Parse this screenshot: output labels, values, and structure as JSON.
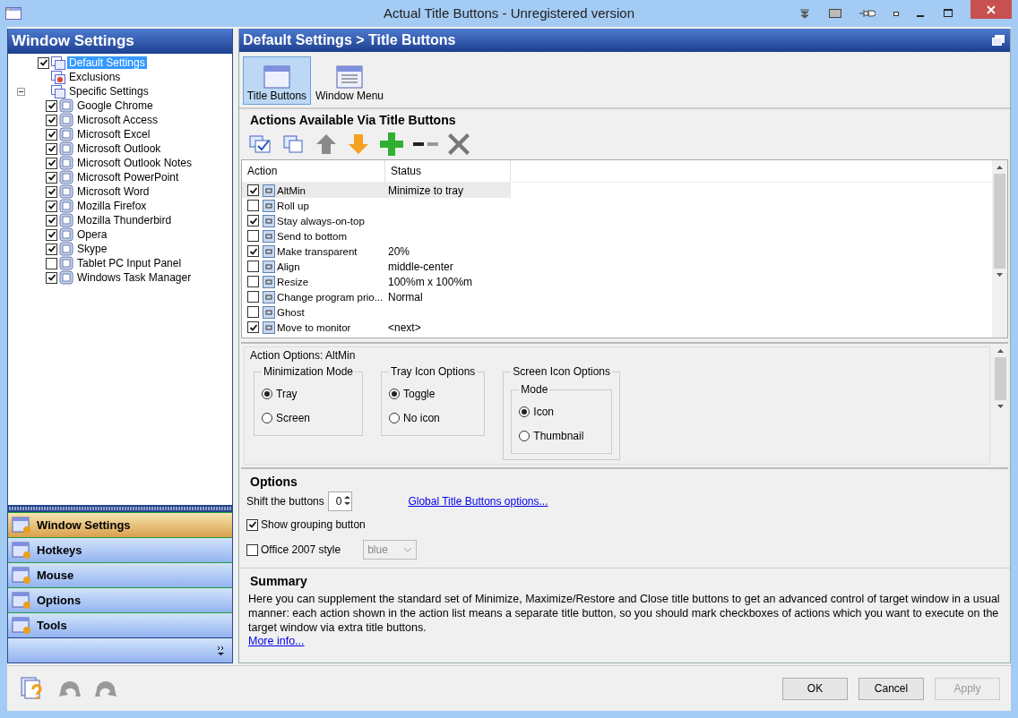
{
  "window": {
    "title": "Actual Title Buttons - Unregistered version"
  },
  "sidebar": {
    "title": "Window Settings",
    "tree": [
      {
        "label": "Default Settings",
        "checked": true,
        "selected": true
      },
      {
        "label": "Exclusions",
        "selected": false
      },
      {
        "label": "Specific Settings",
        "selected": false,
        "expanded": true,
        "children": [
          {
            "label": "Google Chrome",
            "checked": true,
            "selected": false
          },
          {
            "label": "Microsoft Access",
            "checked": true,
            "selected": false
          },
          {
            "label": "Microsoft Excel",
            "checked": true,
            "selected": false
          },
          {
            "label": "Microsoft Outlook",
            "checked": true,
            "selected": false
          },
          {
            "label": "Microsoft Outlook Notes",
            "checked": true,
            "selected": false
          },
          {
            "label": "Microsoft PowerPoint",
            "checked": true,
            "selected": false
          },
          {
            "label": "Microsoft Word",
            "checked": true,
            "selected": false
          },
          {
            "label": "Mozilla Firefox",
            "checked": true,
            "selected": false
          },
          {
            "label": "Mozilla Thunderbird",
            "checked": true,
            "selected": false
          },
          {
            "label": "Opera",
            "checked": true,
            "selected": false
          },
          {
            "label": "Skype",
            "checked": true,
            "selected": false
          },
          {
            "label": "Tablet PC Input Panel",
            "checked": false,
            "selected": false
          },
          {
            "label": "Windows Task Manager",
            "checked": true,
            "selected": false
          }
        ]
      }
    ],
    "nav": [
      {
        "label": "Window Settings",
        "selected": true
      },
      {
        "label": "Hotkeys",
        "selected": false
      },
      {
        "label": "Mouse",
        "selected": false
      },
      {
        "label": "Options",
        "selected": false
      },
      {
        "label": "Tools",
        "selected": false
      }
    ]
  },
  "header": {
    "title": "Default Settings > Title Buttons"
  },
  "tabs": [
    {
      "label": "Title Buttons",
      "selected": true
    },
    {
      "label": "Window Menu",
      "selected": false
    }
  ],
  "actions": {
    "title": "Actions Available Via Title Buttons",
    "columns": [
      "Action",
      "Status"
    ],
    "rows": [
      {
        "checked": true,
        "action": "AltMin",
        "status": "Minimize to tray",
        "selected": true
      },
      {
        "checked": false,
        "action": "Roll up",
        "selected": false
      },
      {
        "checked": true,
        "action": "Stay always-on-top",
        "selected": false
      },
      {
        "checked": false,
        "action": "Send to bottom",
        "selected": false
      },
      {
        "checked": true,
        "action": "Make transparent",
        "status": "20%",
        "selected": false
      },
      {
        "checked": false,
        "action": "Align",
        "status": "middle-center",
        "selected": false
      },
      {
        "checked": false,
        "action": "Resize",
        "status": "100%m x 100%m",
        "selected": false
      },
      {
        "checked": false,
        "action": "Change program prio...",
        "status": "Normal",
        "selected": false
      },
      {
        "checked": false,
        "action": "Ghost",
        "selected": false
      },
      {
        "checked": true,
        "action": "Move to monitor",
        "status": "<next>",
        "selected": false
      }
    ]
  },
  "action_options": {
    "title": "Action Options: AltMin",
    "groups": [
      {
        "title": "Minimization Mode",
        "options": [
          {
            "label": "Tray",
            "selected": true
          },
          {
            "label": "Screen",
            "selected": false
          }
        ]
      },
      {
        "title": "Tray Icon Options",
        "options": [
          {
            "label": "Toggle",
            "selected": true
          },
          {
            "label": "No icon",
            "selected": false
          }
        ]
      },
      {
        "title": "Screen Icon Options",
        "subgroup": {
          "title": "Mode",
          "options": [
            {
              "label": "Icon",
              "selected": true
            },
            {
              "label": "Thumbnail",
              "selected": false
            }
          ]
        }
      }
    ]
  },
  "options": {
    "title": "Options",
    "shift": {
      "label": "Shift the buttons",
      "value": "0"
    },
    "link": "Global Title Buttons options...",
    "show_grouping": {
      "label": "Show grouping button",
      "checked": true
    },
    "office_style": {
      "label": "Office 2007 style",
      "checked": false,
      "dropdown": "blue",
      "dropdown_disabled": true
    }
  },
  "summary": {
    "title": "Summary",
    "text": "Here you can supplement the standard set of Minimize, Maximize/Restore and Close title buttons to get an advanced control of target window in a usual manner: each action shown in the action list means a separate title button, so you should mark checkboxes of actions which you want to execute on the target window via extra title buttons.",
    "link": "More info..."
  },
  "buttons": [
    {
      "label": "OK",
      "disabled": false
    },
    {
      "label": "Cancel",
      "disabled": false
    },
    {
      "label": "Apply",
      "disabled": true
    }
  ]
}
